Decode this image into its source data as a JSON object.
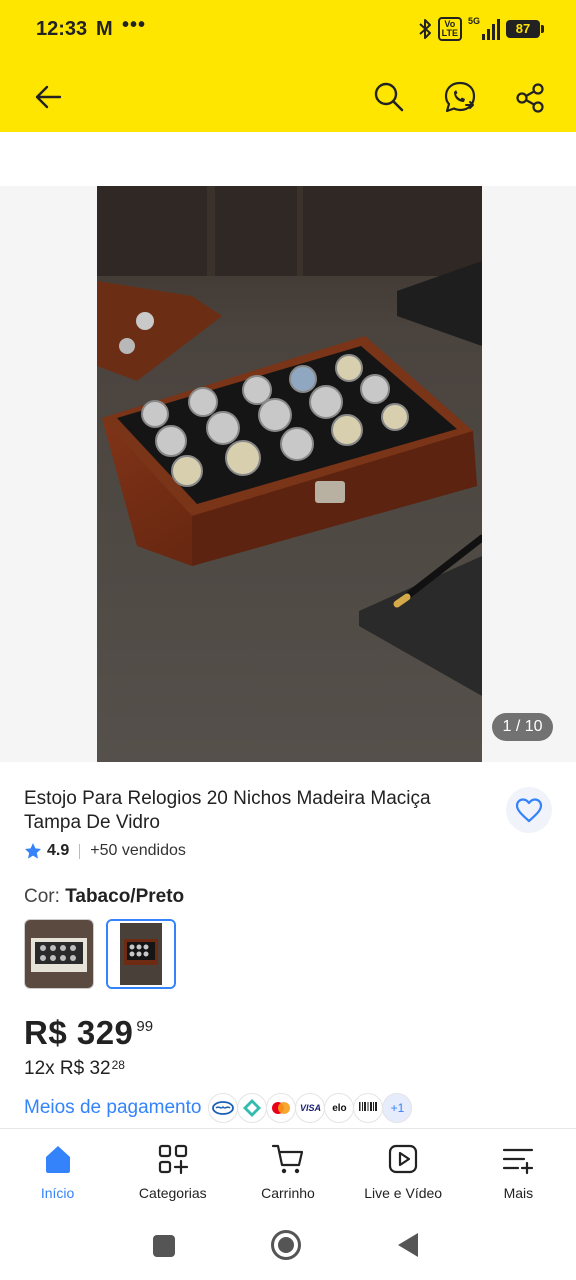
{
  "status_bar": {
    "time": "12:33",
    "carrier_indicator": "M",
    "overflow": "•••",
    "volte_label": "Vo\nLTE",
    "network_label": "5G",
    "battery": "87"
  },
  "header": {
    "back_icon": "arrow-left-icon",
    "search_icon": "search-icon",
    "chat_icon": "chat-share-icon",
    "share_icon": "share-icon",
    "background_color": "#ffe600"
  },
  "gallery": {
    "counter": "1 / 10"
  },
  "product": {
    "title": "Estojo Para Relogios 20 Nichos Madeira Maciça Tampa De Vidro",
    "rating": "4.9",
    "sold": "+50 vendidos",
    "color_label": "Cor: ",
    "color_value": "Tabaco/Preto",
    "price_main": "R$ 329",
    "price_cents": "99",
    "installments_main": "12x R$ 32",
    "installments_cents": "28",
    "payment_link": "Meios de pagamento",
    "payment_more": "+1",
    "payment_methods": [
      "mercado-pago-icon",
      "pix-icon",
      "mastercard-icon",
      "visa-icon",
      "elo-icon",
      "boleto-icon"
    ]
  },
  "bottom_nav": {
    "items": [
      {
        "label": "Início",
        "icon": "home-icon",
        "active": true
      },
      {
        "label": "Categorias",
        "icon": "categories-icon",
        "active": false
      },
      {
        "label": "Carrinho",
        "icon": "cart-icon",
        "active": false
      },
      {
        "label": "Live e Vídeo",
        "icon": "play-video-icon",
        "active": false
      },
      {
        "label": "Mais",
        "icon": "menu-more-icon",
        "active": false
      }
    ]
  },
  "colors": {
    "accent": "#3483fa",
    "brand_yellow": "#ffe600"
  }
}
